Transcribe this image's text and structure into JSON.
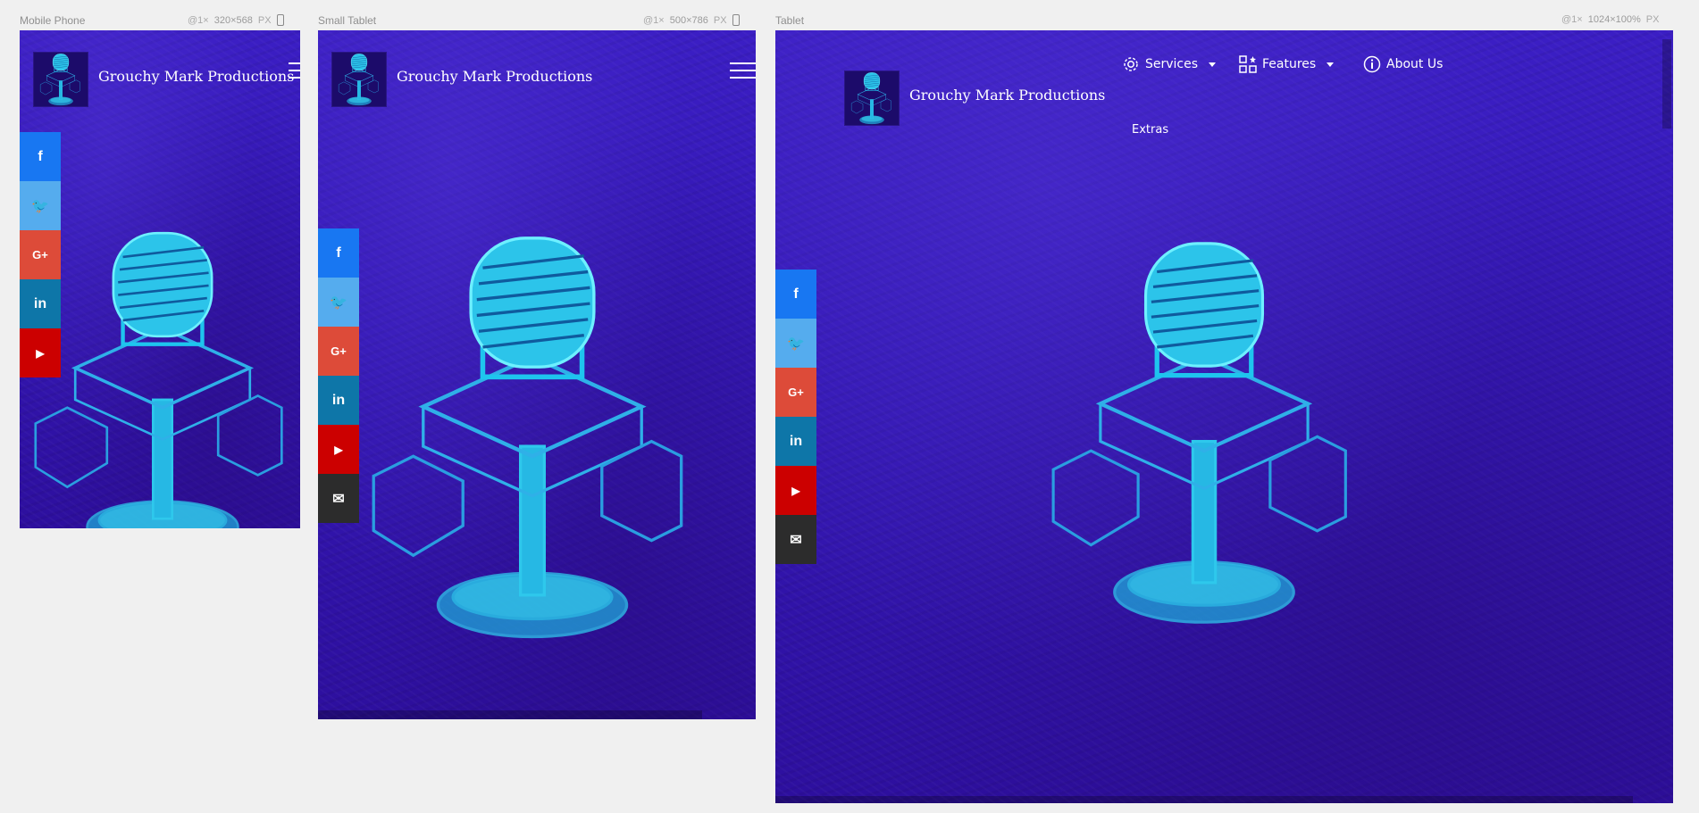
{
  "devices": [
    {
      "label": "Mobile Phone",
      "scale": "@1×",
      "size": "320×568",
      "unit": "PX"
    },
    {
      "label": "Small Tablet",
      "scale": "@1×",
      "size": "500×786",
      "unit": "PX"
    },
    {
      "label": "Tablet",
      "scale": "@1×",
      "size": "1024×100%",
      "unit": "PX"
    }
  ],
  "site": {
    "brand": "Grouchy Mark Productions",
    "nav": [
      {
        "label": "Services",
        "icon": "gear-icon",
        "dropdown": true
      },
      {
        "label": "Features",
        "icon": "grid-icon",
        "dropdown": true
      },
      {
        "label": "About Us",
        "icon": "info-icon",
        "dropdown": false
      }
    ],
    "extras": "Extras",
    "social": [
      {
        "name": "facebook",
        "glyph": "f",
        "color": "#1877f2"
      },
      {
        "name": "twitter",
        "glyph": "🐦",
        "color": "#55acee"
      },
      {
        "name": "google-plus",
        "glyph": "G+",
        "color": "#dd4b39"
      },
      {
        "name": "linkedin",
        "glyph": "in",
        "color": "#0e76a8"
      },
      {
        "name": "youtube",
        "glyph": "▶",
        "color": "#cc0000"
      },
      {
        "name": "email",
        "glyph": "✉",
        "color": "#2c2c2c"
      }
    ]
  }
}
